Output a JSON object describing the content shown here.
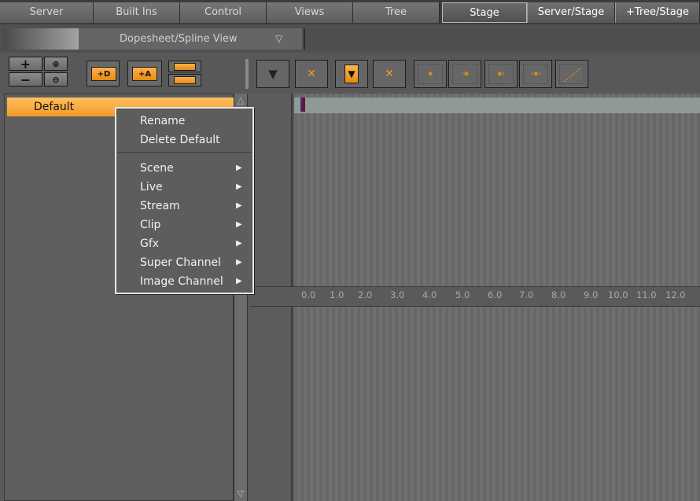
{
  "tabs": [
    "Server",
    "Built Ins",
    "Control",
    "Views",
    "Tree",
    "Stage",
    "Server/Stage",
    "+Tree/Stage"
  ],
  "active_tab": "Stage",
  "view_selector": "Dopesheet/Spline View",
  "tree_item": "Default",
  "context_menu": {
    "top_items": [
      "Rename",
      "Delete Default"
    ],
    "submenus": [
      "Scene",
      "Live",
      "Stream",
      "Clip",
      "Gfx",
      "Super Channel",
      "Image Channel"
    ]
  },
  "ruler_ticks": [
    "0.0",
    "1.0",
    "2.0",
    "3.0",
    "4.0",
    "5.0",
    "6.0",
    "7.0",
    "8.0",
    "9.0",
    "10.0",
    "11.0",
    "12.0"
  ],
  "colors": {
    "accent_orange": "#f29b28",
    "track_bar": "#8f9a96",
    "keyframe_marker": "#6d0f3c"
  },
  "toolbar_icons": [
    "zoom-plus-icon",
    "zoom-in-icon",
    "zoom-minus-icon",
    "zoom-out-icon",
    "add-director-icon",
    "add-actor-icon",
    "move-up-icon",
    "move-down-icon",
    "key-tool-icon",
    "delete-key-icon",
    "key-down-icon",
    "delete-key2-icon",
    "point-icon",
    "in-point-icon",
    "out-point-icon",
    "in-out-point-icon",
    "spline-icon"
  ]
}
